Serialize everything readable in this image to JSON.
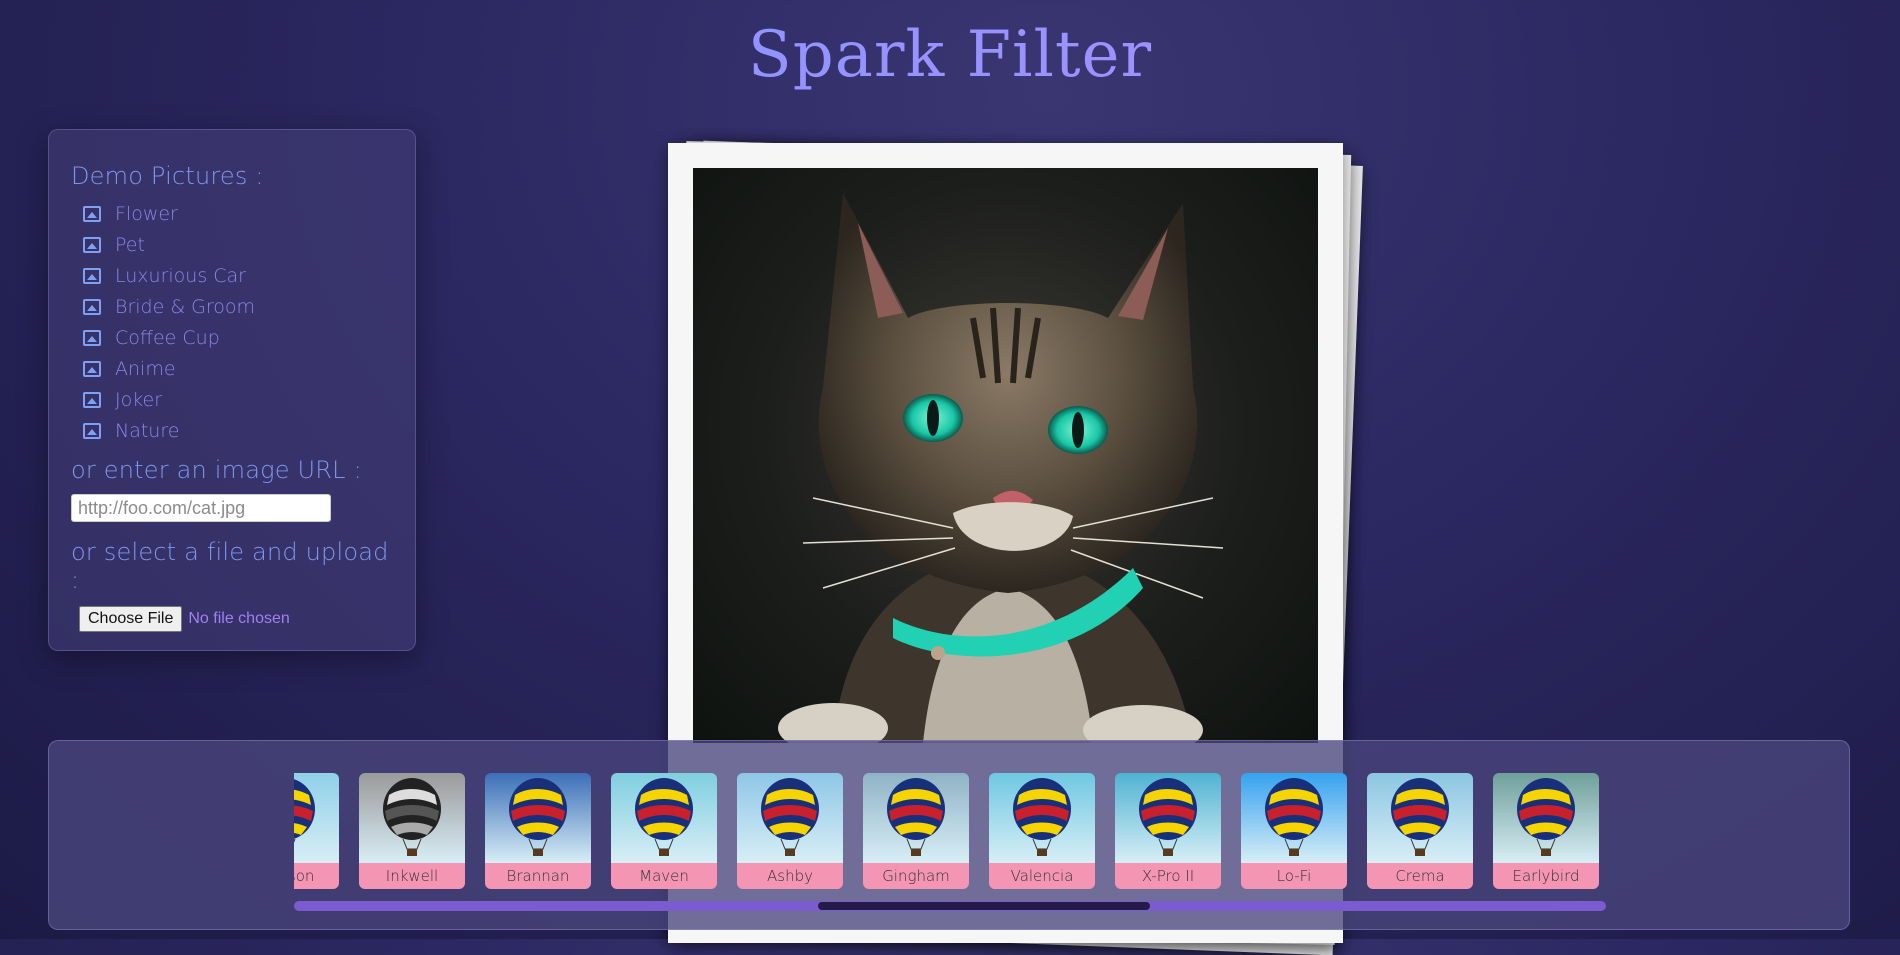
{
  "app": {
    "title": "Spark Filter"
  },
  "sidebar": {
    "demo_heading": "Demo Pictures :",
    "demo_items": [
      "Flower",
      "Pet",
      "Luxurious Car",
      "Bride & Groom",
      "Coffee Cup",
      "Anime",
      "Joker",
      "Nature"
    ],
    "url_heading": "or enter an image URL :",
    "url_placeholder": "http://foo.com/cat.jpg",
    "upload_heading": "or select a file and upload :",
    "file_button": "Choose File",
    "file_status": "No file chosen"
  },
  "filters": {
    "items": [
      {
        "name": "Hudson",
        "sky": "#8fd0e8"
      },
      {
        "name": "Inkwell",
        "sky": "#9a9a9a"
      },
      {
        "name": "Brannan",
        "sky": "#3b6fb8"
      },
      {
        "name": "Maven",
        "sky": "#7fcfe0"
      },
      {
        "name": "Ashby",
        "sky": "#8ec7e6"
      },
      {
        "name": "Gingham",
        "sky": "#8fb3c6"
      },
      {
        "name": "Valencia",
        "sky": "#6ec8e2"
      },
      {
        "name": "X-Pro II",
        "sky": "#4fb3d2"
      },
      {
        "name": "Lo-Fi",
        "sky": "#35a2f0"
      },
      {
        "name": "Crema",
        "sky": "#8bc6e2"
      },
      {
        "name": "Earlybird",
        "sky": "#6f9f9a"
      }
    ]
  },
  "colors": {
    "accent": "#7e97ee",
    "caption": "#f595b4",
    "scrollbar": "#7a5bd0"
  }
}
